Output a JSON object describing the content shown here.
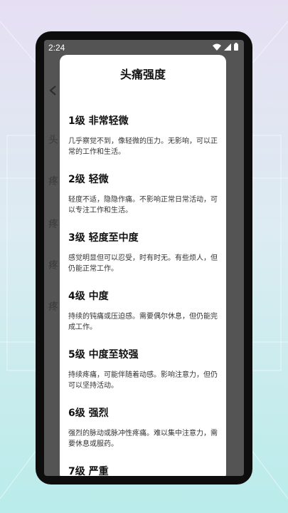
{
  "status_bar": {
    "time": "2:24",
    "icons": [
      "wifi-icon",
      "signal-icon",
      "battery-icon"
    ]
  },
  "background_page": {
    "rows": [
      "头",
      "疼",
      "疼",
      "疼",
      "疼"
    ]
  },
  "dialog": {
    "title": "头痛强度",
    "levels": [
      {
        "title": "1级  非常轻微",
        "desc": "几乎察觉不到，像轻微的压力。无影响，可以正常的工作和生活。"
      },
      {
        "title": "2级  轻微",
        "desc": "轻度不适，隐隐作痛。不影响正常日常活动，可以专注工作和生活。"
      },
      {
        "title": "3级  轻度至中度",
        "desc": "感觉明显但可以忍受，时有时无。有些烦人，但仍能正常工作。"
      },
      {
        "title": "4级  中度",
        "desc": "持续的钝痛或压迫感。需要偶尔休息，但仍能完成工作。"
      },
      {
        "title": "5级  中度至较强",
        "desc": "持续疼痛，可能伴随着动感。影响注意力，但仍可以坚持活动。"
      },
      {
        "title": "6级  强烈",
        "desc": "强烈的脉动或脉冲性疼痛。难以集中注意力，需要休息或服药。"
      },
      {
        "title": "7级  严重",
        "desc": ""
      }
    ]
  },
  "colors": {
    "scrim": "#545454",
    "dialog_bg": "#ffffff",
    "frame": "#0d0d0d"
  }
}
